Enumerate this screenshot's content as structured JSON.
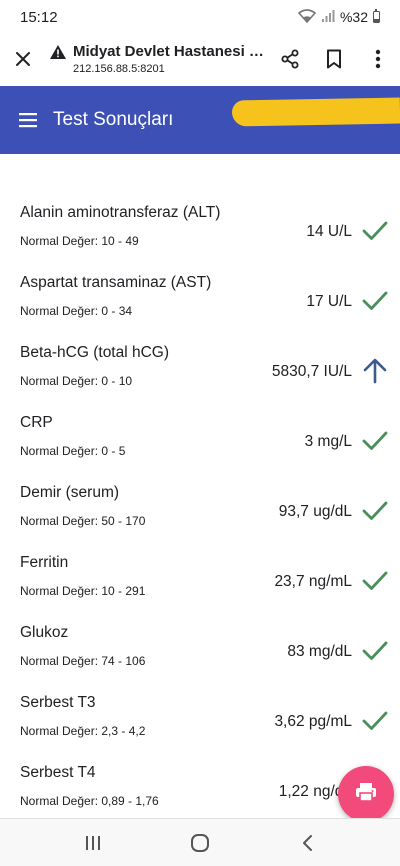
{
  "status_bar": {
    "time": "15:12",
    "battery_text": "%32"
  },
  "custom_tab": {
    "title": "Midyat Devlet Hastanesi : H...",
    "url": "212.156.88.5:8201",
    "icons": [
      "close-icon",
      "warning-icon",
      "share-icon",
      "bookmark-icon",
      "more-vert-icon"
    ]
  },
  "app_header": {
    "title": "Test Sonuçları",
    "background_color": "#3d50b5"
  },
  "results": [
    {
      "name": "Alanin aminotransferaz (ALT)",
      "range": "Normal Değer: 10 - 49",
      "value": "14 U/L",
      "status": "normal"
    },
    {
      "name": "Aspartat transaminaz (AST)",
      "range": "Normal Değer: 0 - 34",
      "value": "17 U/L",
      "status": "normal"
    },
    {
      "name": "Beta-hCG (total hCG)",
      "range": "Normal Değer: 0 - 10",
      "value": "5830,7 IU/L",
      "status": "high"
    },
    {
      "name": "CRP",
      "range": "Normal Değer: 0 - 5",
      "value": "3 mg/L",
      "status": "normal"
    },
    {
      "name": "Demir (serum)",
      "range": "Normal Değer: 50 - 170",
      "value": "93,7 ug/dL",
      "status": "normal"
    },
    {
      "name": "Ferritin",
      "range": "Normal Değer: 10 - 291",
      "value": "23,7 ng/mL",
      "status": "normal"
    },
    {
      "name": "Glukoz",
      "range": "Normal Değer: 74 - 106",
      "value": "83 mg/dL",
      "status": "normal"
    },
    {
      "name": "Serbest T3",
      "range": "Normal Değer: 2,3 - 4,2",
      "value": "3,62 pg/mL",
      "status": "normal"
    },
    {
      "name": "Serbest T4",
      "range": "Normal Değer: 0,89 - 1,76",
      "value": "1,22 ng/dL",
      "status": "normal"
    }
  ],
  "colors": {
    "check_green": "#4a8f5a",
    "arrow_up_blue": "#3d5a8c",
    "fab_pink": "#f24a7a"
  },
  "fab": {
    "icon": "print-icon"
  },
  "nav_bar": {
    "icons": [
      "recent-apps-icon",
      "home-icon",
      "back-icon"
    ]
  }
}
